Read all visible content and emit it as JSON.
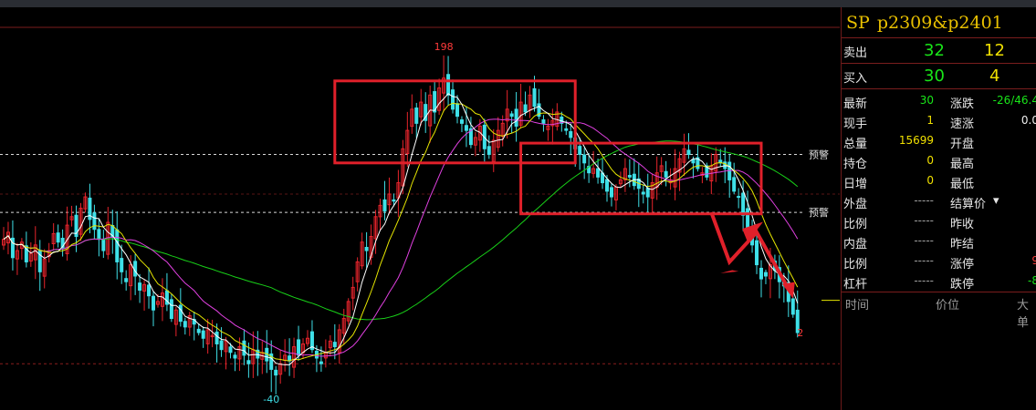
{
  "chart_data": {
    "type": "candlestick",
    "title": "",
    "xlabel": "",
    "ylabel": "",
    "ylim": [
      -45,
      205
    ],
    "annotations": {
      "high_label": "198",
      "low_label": "-40",
      "last_label": "2",
      "warning_label": "预警"
    },
    "warning_lines": [
      128,
      87
    ],
    "lower_line": -20,
    "high": {
      "index": 97,
      "value": 198
    },
    "low": {
      "index": 59,
      "value": -40
    },
    "closes": [
      68,
      73,
      55,
      60,
      66,
      52,
      58,
      64,
      45,
      54,
      60,
      72,
      66,
      62,
      78,
      84,
      70,
      90,
      98,
      82,
      75,
      68,
      60,
      80,
      70,
      52,
      45,
      38,
      50,
      42,
      32,
      36,
      28,
      18,
      24,
      30,
      22,
      12,
      18,
      10,
      6,
      14,
      8,
      2,
      -2,
      4,
      0,
      -6,
      -10,
      -4,
      -12,
      -16,
      -8,
      -14,
      -20,
      -10,
      -16,
      -12,
      -18,
      -24,
      -28,
      -20,
      -14,
      -18,
      -8,
      -14,
      -6,
      -2,
      -10,
      -16,
      -20,
      -12,
      -4,
      -8,
      4,
      12,
      24,
      34,
      52,
      66,
      60,
      70,
      84,
      92,
      88,
      100,
      95,
      108,
      132,
      145,
      160,
      150,
      165,
      152,
      170,
      158,
      175,
      182,
      170,
      160,
      155,
      150,
      145,
      135,
      140,
      148,
      132,
      128,
      138,
      145,
      150,
      160,
      155,
      148,
      165,
      158,
      170,
      162,
      155,
      150,
      148,
      152,
      158,
      150,
      145,
      140,
      132,
      128,
      122,
      115,
      118,
      112,
      108,
      102,
      98,
      105,
      110,
      118,
      112,
      106,
      104,
      100,
      98,
      108,
      115,
      120,
      112,
      110,
      118,
      125,
      132,
      128,
      122,
      118,
      115,
      112,
      120,
      128,
      122,
      118,
      110,
      102,
      98,
      85,
      75,
      64,
      50,
      40,
      42,
      50,
      46,
      38,
      35,
      24,
      15,
      2
    ]
  },
  "warning_tags": [
    "预警",
    "预警"
  ],
  "panel": {
    "title_code": "SP",
    "title_name": "p2309&p2401",
    "sell_label": "卖出",
    "sell_price": "32",
    "sell_qty": "12",
    "buy_label": "买入",
    "buy_price": "30",
    "buy_qty": "4",
    "rows": [
      {
        "l1": "最新",
        "v1": "30",
        "l2": "涨跌",
        "v2": "-26/46.4"
      },
      {
        "l1": "现手",
        "v1": "1",
        "l2": "速涨",
        "v2": "0.0"
      },
      {
        "l1": "总量",
        "v1": "15699",
        "l2": "开盘",
        "v2": ""
      },
      {
        "l1": "持仓",
        "v1": "0",
        "l2": "最高",
        "v2": ""
      },
      {
        "l1": "日增",
        "v1": "0",
        "l2": "最低",
        "v2": ""
      },
      {
        "l1": "外盘",
        "v1": "-----",
        "l2": "结算价",
        "v2": ""
      },
      {
        "l1": "比例",
        "v1": "-----",
        "l2": "昨收",
        "v2": ""
      },
      {
        "l1": "内盘",
        "v1": "-----",
        "l2": "昨结",
        "v2": ""
      },
      {
        "l1": "比例",
        "v1": "-----",
        "l2": "涨停",
        "v2": "9"
      },
      {
        "l1": "杠杆",
        "v1": "-----",
        "l2": "跌停",
        "v2": "-8"
      }
    ],
    "footer": {
      "time": "时间",
      "price": "价位",
      "volume": "大单"
    },
    "colors": {
      "up": "#e8242c",
      "down": "#3fe0e8",
      "ma5": "#ffffff",
      "ma10": "#e6e600",
      "ma20": "#e040e0",
      "ma60": "#18d018",
      "box": "#e0202a"
    }
  }
}
